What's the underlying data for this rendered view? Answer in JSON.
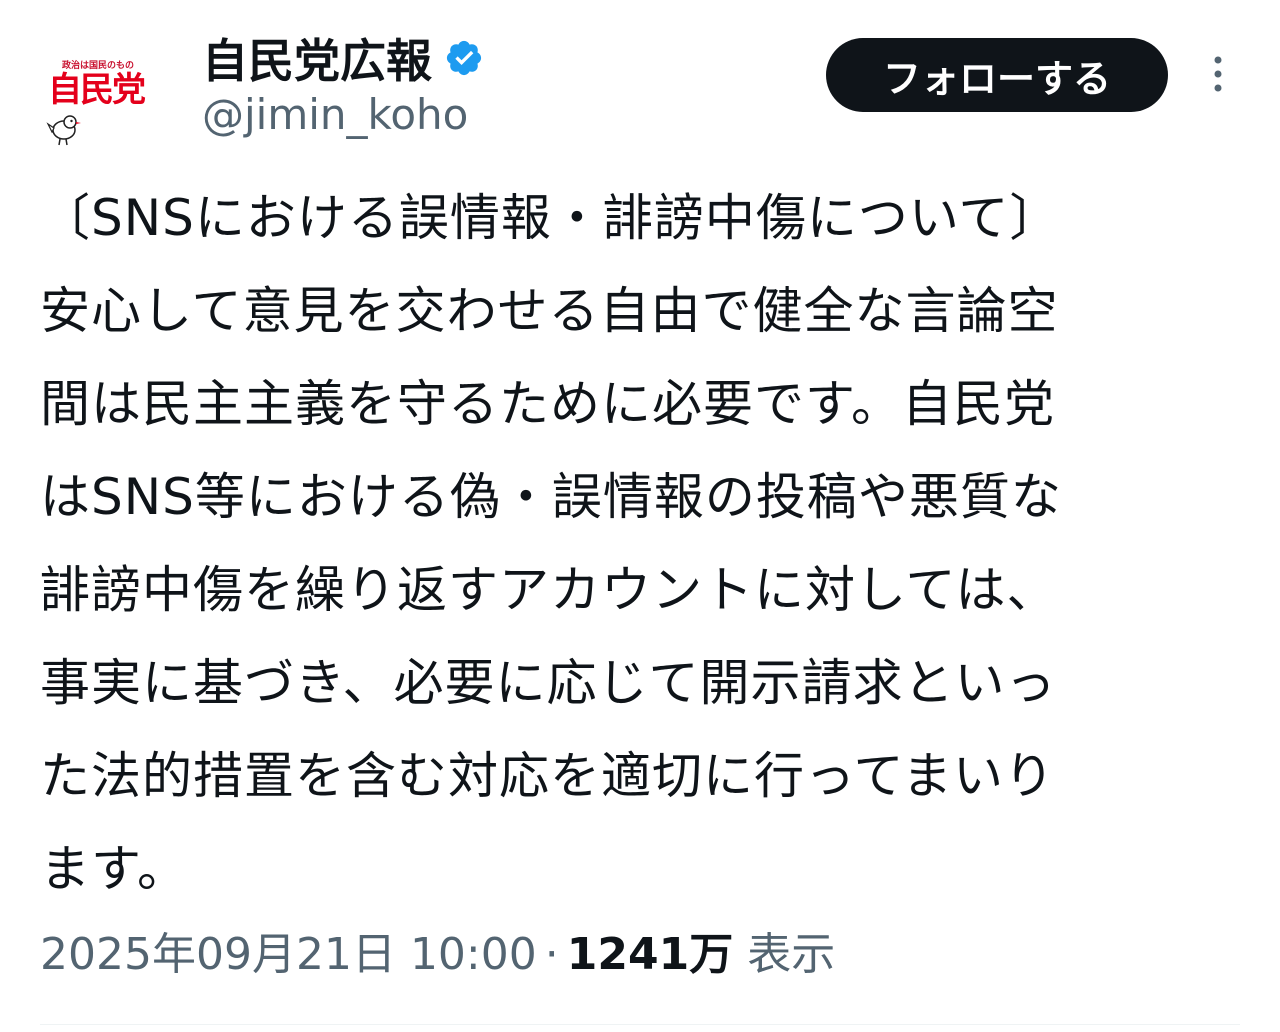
{
  "author": {
    "display_name": "自民党広報",
    "handle": "@jimin_koho",
    "verified": true,
    "avatar": {
      "slogan": "政治は国民のもの",
      "logo_text": "自民党"
    }
  },
  "follow_button": {
    "label": "フォローする"
  },
  "more_menu": {
    "icon": "more-vertical-icon"
  },
  "tweet": {
    "lines": [
      "〔SNSにおける誤情報・誹謗中傷について〕",
      "安心して意見を交わせる自由で健全な言論空",
      "間は民主主義を守るために必要です。自民党",
      "はSNS等における偽・誤情報の投稿や悪質な",
      "誹謗中傷を繰り返すアカウントに対しては、",
      "事実に基づき、必要に応じて開示請求といっ",
      "た法的措置を含む対応を適切に行ってまいり",
      "ます。"
    ]
  },
  "meta": {
    "timestamp": "2025年09月21日 10:00",
    "separator": "·",
    "views_count": "1241万",
    "views_label": "表示"
  },
  "colors": {
    "primary_text": "#0f1419",
    "secondary_text": "#536471",
    "verified_badge": "#1d9bf0",
    "logo_red": "#e4001b",
    "follow_bg": "#0f1419"
  }
}
